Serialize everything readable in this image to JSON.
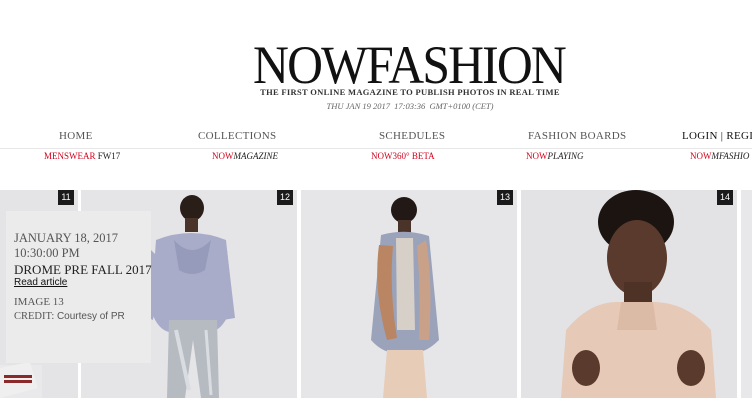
{
  "masthead": {
    "logo": "NOWFASHION",
    "tagline": "THE FIRST ONLINE MAGAZINE TO PUBLISH PHOTOS IN REAL TIME",
    "date": "THU JAN 19 2017",
    "time": "17:03:36",
    "timezone": "GMT+0100 (CET)"
  },
  "nav": {
    "home": "HOME",
    "collections": "COLLECTIONS",
    "schedules": "SCHEDULES",
    "fashion_boards": "FASHION BOARDS",
    "login": "LOGIN | REGIS"
  },
  "subnav": {
    "menswear": {
      "highlight": "MENSWEAR",
      "rest": "FW17"
    },
    "magazine": {
      "highlight": "NOW",
      "rest": "MAGAZINE"
    },
    "now360": {
      "highlight": "NOW",
      "rest": "360° BETA"
    },
    "playing": {
      "highlight": "NOW",
      "rest": "PLAYING"
    },
    "mfashion": {
      "highlight": "NOW",
      "rest": "MFASHIO"
    }
  },
  "gallery": {
    "photos": [
      {
        "number": "11"
      },
      {
        "number": "12"
      },
      {
        "number": "13"
      },
      {
        "number": "14"
      }
    ]
  },
  "info": {
    "date": "JANUARY 18, 2017",
    "time": "10:30:00 PM",
    "title": "DROME PRE FALL 2017",
    "read_more": "Read article",
    "image_number": "IMAGE 13",
    "credit_label": "CREDIT:",
    "credit_value": "Courtesy of PR"
  },
  "colors": {
    "accent": "#d0021b",
    "photo_bg": "#e6e6e8",
    "info_bg": "#ebebeb"
  }
}
